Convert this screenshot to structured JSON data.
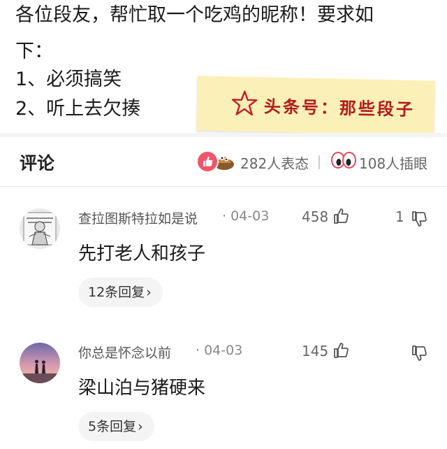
{
  "post": {
    "lines": [
      "各位段友，帮忙取一个吃鸡的昵称！要求如",
      "下：",
      "1、必须搞笑",
      "2、听上去欠揍"
    ],
    "watermark": "头条号：那些段子"
  },
  "comments_header": {
    "title": "评论",
    "reactions_count": "282人表态",
    "eyes_count": "108人插眼"
  },
  "comments": [
    {
      "user": "查拉图斯特拉如是说",
      "date": "· 04-03",
      "likes": "458",
      "dislikes": "1",
      "text": "先打老人和孩子",
      "replies": "12条回复"
    },
    {
      "user": "你总是怀念以前",
      "date": "· 04-03",
      "likes": "145",
      "dislikes": "",
      "text": "梁山泊与猪硬来",
      "replies": "5条回复"
    }
  ],
  "colors": {
    "sticky_bg": "#fbf0b7",
    "watermark_red": "#b01c1c",
    "like_pink": "#f0566a"
  },
  "icons": [
    "star-icon",
    "thumbs-up-icon",
    "thumbs-down-icon",
    "eyes-icon",
    "chevron-right-icon"
  ]
}
